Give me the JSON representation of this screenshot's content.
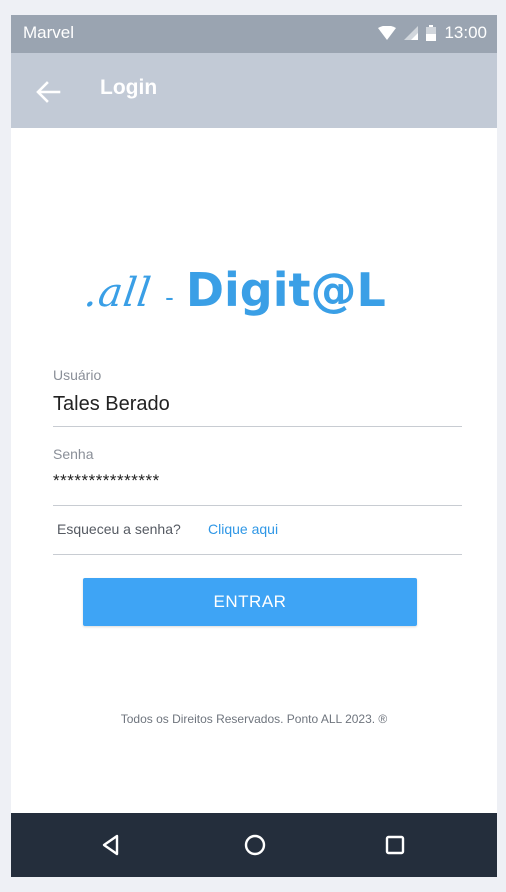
{
  "status_bar": {
    "carrier": "Marvel",
    "time": "13:00"
  },
  "app_bar": {
    "title": "Login"
  },
  "logo": {
    "part_all": ".all",
    "dash": "-",
    "part_digital": "Digit@L"
  },
  "form": {
    "username_label": "Usuário",
    "username_value": "Tales Berado",
    "password_label": "Senha",
    "password_value": "***************",
    "forgot_text": "Esqueceu a senha?",
    "forgot_link": "Clique aqui",
    "submit_label": "ENTRAR"
  },
  "footer": {
    "copyright": "Todos os Direitos Reservados. Ponto ALL 2023. ®"
  },
  "icons": {
    "back": "arrow-left-icon",
    "wifi": "wifi-icon",
    "signal": "signal-icon",
    "battery": "battery-icon",
    "nav_back": "triangle-back-icon",
    "nav_home": "circle-home-icon",
    "nav_recent": "square-recent-icon"
  },
  "colors": {
    "status_bar": "#9aa4b1",
    "app_bar": "#c2cad6",
    "accent": "#3ea4f5",
    "link": "#2f97e6",
    "nav_bar": "#242e3c"
  }
}
